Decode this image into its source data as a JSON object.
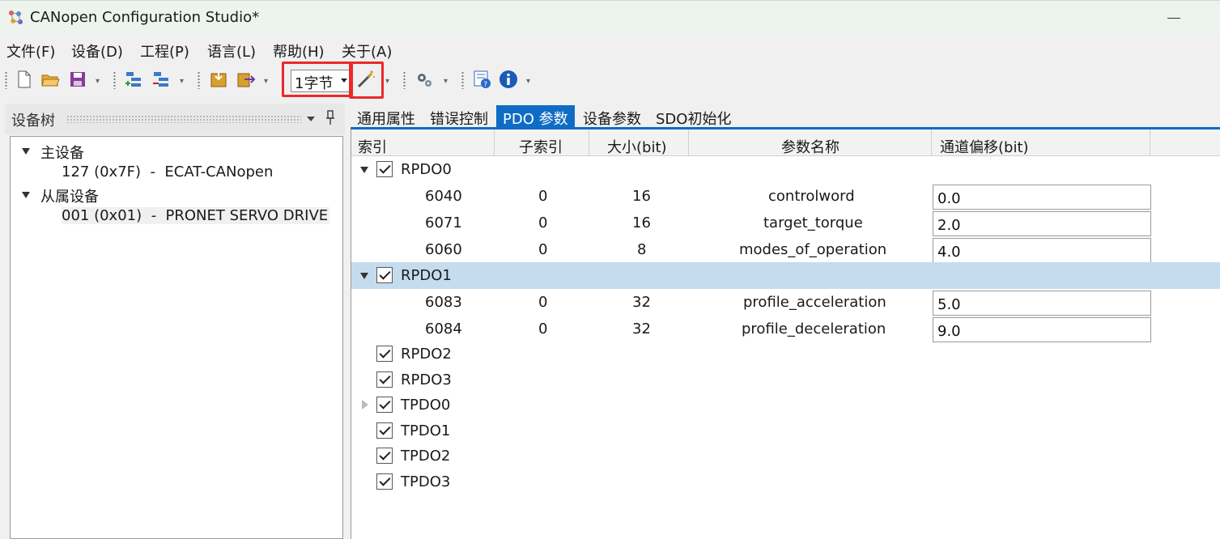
{
  "window": {
    "title": "CANopen Configuration Studio*"
  },
  "menu": [
    "文件(F)",
    "设备(D)",
    "工程(P)",
    "语言(L)",
    "帮助(H)",
    "关于(A)"
  ],
  "toolbar": {
    "unit_select": "1字节",
    "icons": [
      "new-file-icon",
      "open-folder-icon",
      "save-icon",
      "add-device-icon",
      "remove-device-icon",
      "import-icon",
      "export-icon",
      "magic-wand-icon",
      "settings-gears-icon",
      "help-icon",
      "info-icon"
    ],
    "highlight_color": "#ea2a2a"
  },
  "device_tree": {
    "title": "设备树",
    "nodes": [
      {
        "label": "主设备",
        "expanded": true
      },
      {
        "label": "127 (0x7F)  -  ECAT-CANopen"
      },
      {
        "label": "从属设备",
        "expanded": true
      },
      {
        "label": "001 (0x01)  -  PRONET SERVO DRIVE",
        "selected": true
      }
    ]
  },
  "tabs": [
    {
      "label": "通用属性"
    },
    {
      "label": "错误控制"
    },
    {
      "label": "PDO 参数",
      "active": true
    },
    {
      "label": "设备参数"
    },
    {
      "label": "SDO初始化"
    }
  ],
  "accent_color": "#0f6cc4",
  "grid": {
    "columns": [
      "索引",
      "子索引",
      "大小(bit)",
      "参数名称",
      "通道偏移(bit)"
    ],
    "rows": [
      {
        "type": "group",
        "label": "RPDO0",
        "expanded": true,
        "checked": true
      },
      {
        "type": "entry",
        "index": "6040",
        "sub": "0",
        "size": "16",
        "name": "controlword",
        "offset": "0.0"
      },
      {
        "type": "entry",
        "index": "6071",
        "sub": "0",
        "size": "16",
        "name": "target_torque",
        "offset": "2.0"
      },
      {
        "type": "entry",
        "index": "6060",
        "sub": "0",
        "size": "8",
        "name": "modes_of_operation",
        "offset": "4.0"
      },
      {
        "type": "group",
        "label": "RPDO1",
        "expanded": true,
        "checked": true,
        "selected": true
      },
      {
        "type": "entry",
        "index": "6083",
        "sub": "0",
        "size": "32",
        "name": "profile_acceleration",
        "offset": "5.0"
      },
      {
        "type": "entry",
        "index": "6084",
        "sub": "0",
        "size": "32",
        "name": "profile_deceleration",
        "offset": "9.0"
      },
      {
        "type": "group",
        "label": "RPDO2",
        "checked": true
      },
      {
        "type": "group",
        "label": "RPDO3",
        "checked": true
      },
      {
        "type": "group",
        "label": "TPDO0",
        "checked": true,
        "collapsed": true
      },
      {
        "type": "group",
        "label": "TPDO1",
        "checked": true
      },
      {
        "type": "group",
        "label": "TPDO2",
        "checked": true
      },
      {
        "type": "group",
        "label": "TPDO3",
        "checked": true
      }
    ]
  }
}
